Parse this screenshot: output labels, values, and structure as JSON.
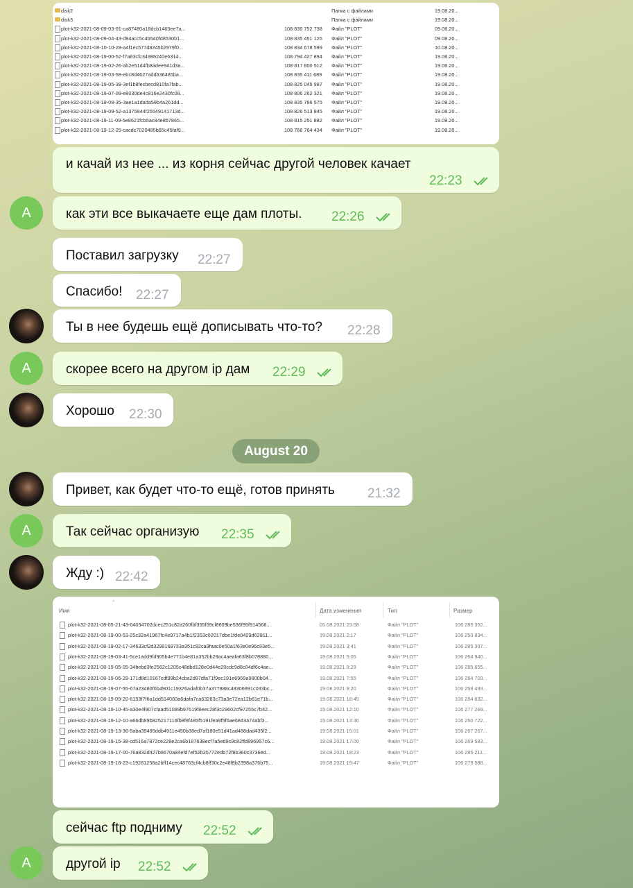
{
  "file_list_1": {
    "rows": [
      {
        "name": "disk2",
        "size": "",
        "type": "Папка с файлами",
        "date": "19.08.20...",
        "folder": true
      },
      {
        "name": "disk3",
        "size": "",
        "type": "Папка с файлами",
        "date": "19.08.20...",
        "folder": true
      },
      {
        "name": "plot-k32-2021-08-09-03-01-ca87480a18dcb1463ee7a...",
        "size": "108 835 752 738",
        "type": "Файл \"PLOT\"",
        "date": "09.08.20..."
      },
      {
        "name": "plot-k32-2021-08-09-04-43-d94acc5c4b540fd8530b1...",
        "size": "108 835 451 125",
        "type": "Файл \"PLOT\"",
        "date": "09.08.20..."
      },
      {
        "name": "plot-k32-2021-08-10-10-28-a4f1ec577d8245b2979f0...",
        "size": "108 834 678 599",
        "type": "Файл \"PLOT\"",
        "date": "10.08.20..."
      },
      {
        "name": "plot-k32-2021-08-19-00-52-f7a83cfc34986240e6314...",
        "size": "108 794 427 894",
        "type": "Файл \"PLOT\"",
        "date": "19.08.20..."
      },
      {
        "name": "plot-k32-2021-08-19-02-26-ab2e51d4fb8adee941d3a...",
        "size": "108 817 800 512",
        "type": "Файл \"PLOT\"",
        "date": "19.08.20..."
      },
      {
        "name": "plot-k32-2021-08-19-03-58-ebc8d4627add636485ba...",
        "size": "108 835 411 689",
        "type": "Файл \"PLOT\"",
        "date": "19.08.20..."
      },
      {
        "name": "plot-k32-2021-08-19-05-38-3ef1b8fecbecd810fa7fab...",
        "size": "108 825 045 987",
        "type": "Файл \"PLOT\"",
        "date": "19.08.20..."
      },
      {
        "name": "plot-k32-2021-08-19-07-09-e8030de4c816e2430fc08...",
        "size": "108 806 262 321",
        "type": "Файл \"PLOT\"",
        "date": "19.08.20..."
      },
      {
        "name": "plot-k32-2021-08-19-08-35-3ae1a1dada59b4a261dd...",
        "size": "108 835 786 575",
        "type": "Файл \"PLOT\"",
        "date": "19.08.20..."
      },
      {
        "name": "plot-k32-2021-08-19-09-52-a1375844f25549141713d...",
        "size": "108 826 513 845",
        "type": "Файл \"PLOT\"",
        "date": "19.08.20..."
      },
      {
        "name": "plot-k32-2021-08-19-11-09-5e8621fcb5ac84e8b7865...",
        "size": "108 815 251 882",
        "type": "Файл \"PLOT\"",
        "date": "19.08.20..."
      },
      {
        "name": "plot-k32-2021-08-19-12-25-cacdc7020485b65c45faf9...",
        "size": "108 768 764 434",
        "type": "Файл \"PLOT\"",
        "date": "19.08.20..."
      }
    ]
  },
  "messages": [
    {
      "id": "m1",
      "text": "и качай из нее ...   из корня сейчас другой человек качает",
      "time": "22:23"
    },
    {
      "id": "m2",
      "text": "как эти все выкачаете  еще дам плоты.",
      "time": "22:26"
    },
    {
      "id": "m3",
      "text": "Поставил загрузку",
      "time": "22:27"
    },
    {
      "id": "m4",
      "text": "Спасибо!",
      "time": "22:27"
    },
    {
      "id": "m5",
      "text": "Ты в нее будешь ещё дописывать что-то?",
      "time": "22:28"
    },
    {
      "id": "m6",
      "text": "скорее всего на другом ip дам",
      "time": "22:29"
    },
    {
      "id": "m7",
      "text": "Хорошо",
      "time": "22:30"
    },
    {
      "id": "m8",
      "text": "Привет, как будет что-то ещё, готов принять",
      "time": "21:32"
    },
    {
      "id": "m9",
      "text": "Так сейчас организую",
      "time": "22:35"
    },
    {
      "id": "m10",
      "text": "Жду :)",
      "time": "22:42"
    },
    {
      "id": "m11",
      "text": "сейчас ftp подниму",
      "time": "22:52"
    },
    {
      "id": "m12",
      "text": "другой ip",
      "time": "22:52"
    }
  ],
  "avatar_letter": "A",
  "date_separator": "August 20",
  "file_list_2": {
    "headers": {
      "name": "Имя",
      "date": "Дата изменения",
      "type": "Тип",
      "size": "Размер"
    },
    "rows": [
      {
        "name": "plot-k32-2021-08-05-21-43-64034702dcec251c82a260fbf355f59cf8609be536f95f914568...",
        "date": "05.08.2021 23:08",
        "type": "Файл \"PLOT\"",
        "size": "106 285 352..."
      },
      {
        "name": "plot-k32-2021-08-19-00-53-25c32a41967fc4e9717a4b1f2353c02017dbe1fde0429d62811...",
        "date": "19.08.2021 2:17",
        "type": "Файл \"PLOT\"",
        "size": "106 250 834..."
      },
      {
        "name": "plot-k32-2021-08-19-02-17-34633cf2d3299169733a351c92ca9faac0e50a1f63e0e96c93e5...",
        "date": "19.08.2021 3:41",
        "type": "Файл \"PLOT\"",
        "size": "106 285 397..."
      },
      {
        "name": "plot-k32-2021-08-19-03-41-5ce1add9fd905b4e771b4e81a352bb29ac4aeafa63f8b078880...",
        "date": "19.08.2021 5:05",
        "type": "Файл \"PLOT\"",
        "size": "106 264 940..."
      },
      {
        "name": "plot-k32-2021-08-19-05-05-34bebd3fe2562c1205c48dbd128e0d44e20cdc9d8c04df6c4ae...",
        "date": "19.08.2021 6:29",
        "type": "Файл \"PLOT\"",
        "size": "106 285 655..."
      },
      {
        "name": "plot-k32-2021-08-19-06-29-171d8d10167cdf99b24cba2d87dfa71f9ec191e6969a9800b04...",
        "date": "19.08.2021 7:55",
        "type": "Файл \"PLOT\"",
        "size": "106 284 709..."
      },
      {
        "name": "plot-k32-2021-08-19-07-55-67a23480f0b4901c19376adaf0b37a377888c48306991c033bc...",
        "date": "19.08.2021 9:20",
        "type": "Файл \"PLOT\"",
        "size": "106 258 493..."
      },
      {
        "name": "plot-k32-2021-08-19-09-20-6153f7f6a1dd514083a6dafa7ca63263c73a3e72ea12b61e71b...",
        "date": "19.08.2021 10:45",
        "type": "Файл \"PLOT\"",
        "size": "106 284 632..."
      },
      {
        "name": "plot-k32-2021-08-19-10-45-a30e4f907cfaad51089b97619f8eec28f3c29602cf97255c7b42...",
        "date": "19.08.2021 12:10",
        "type": "Файл \"PLOT\"",
        "size": "106 277 269..."
      },
      {
        "name": "plot-k32-2021-08-19-12-10-a66db89b825217116fb8f9f485f5191fea9f5f6ae6843a74abf3...",
        "date": "19.08.2021 13:36",
        "type": "Файл \"PLOT\"",
        "size": "106 250 722..."
      },
      {
        "name": "plot-k32-2021-08-19-13-36-5aba39495ddb4911e450b38ed7af180e51d41ad488dad435f2...",
        "date": "19.08.2021 15:01",
        "type": "Файл \"PLOT\"",
        "size": "106 267 267..."
      },
      {
        "name": "plot-k32-2021-08-19-15-38-cd516a7872ce228e2ca6b187638ecf7a5ed9c9c82ffd896957c6...",
        "date": "19.08.2021 17:00",
        "type": "Файл \"PLOT\"",
        "size": "106 269 583..."
      },
      {
        "name": "plot-k32-2021-08-19-17-00-76a832d427b8670a84efd7ef52b25772edb72f8b360c3736ed...",
        "date": "19.08.2021 18:23",
        "type": "Файл \"PLOT\"",
        "size": "106 285 211..."
      },
      {
        "name": "plot-k32-2021-08-19-18-23-c19281258a2bff14cec48763cf4cb8ff30c2e48f8b2398a376b75...",
        "date": "19.08.2021 19:47",
        "type": "Файл \"PLOT\"",
        "size": "106 278 588..."
      }
    ]
  },
  "colors": {
    "outgoing": "#effdde",
    "incoming": "#ffffff",
    "out_time": "#5fba59",
    "in_time": "#a4abb2",
    "avatar": "#78c85a"
  }
}
